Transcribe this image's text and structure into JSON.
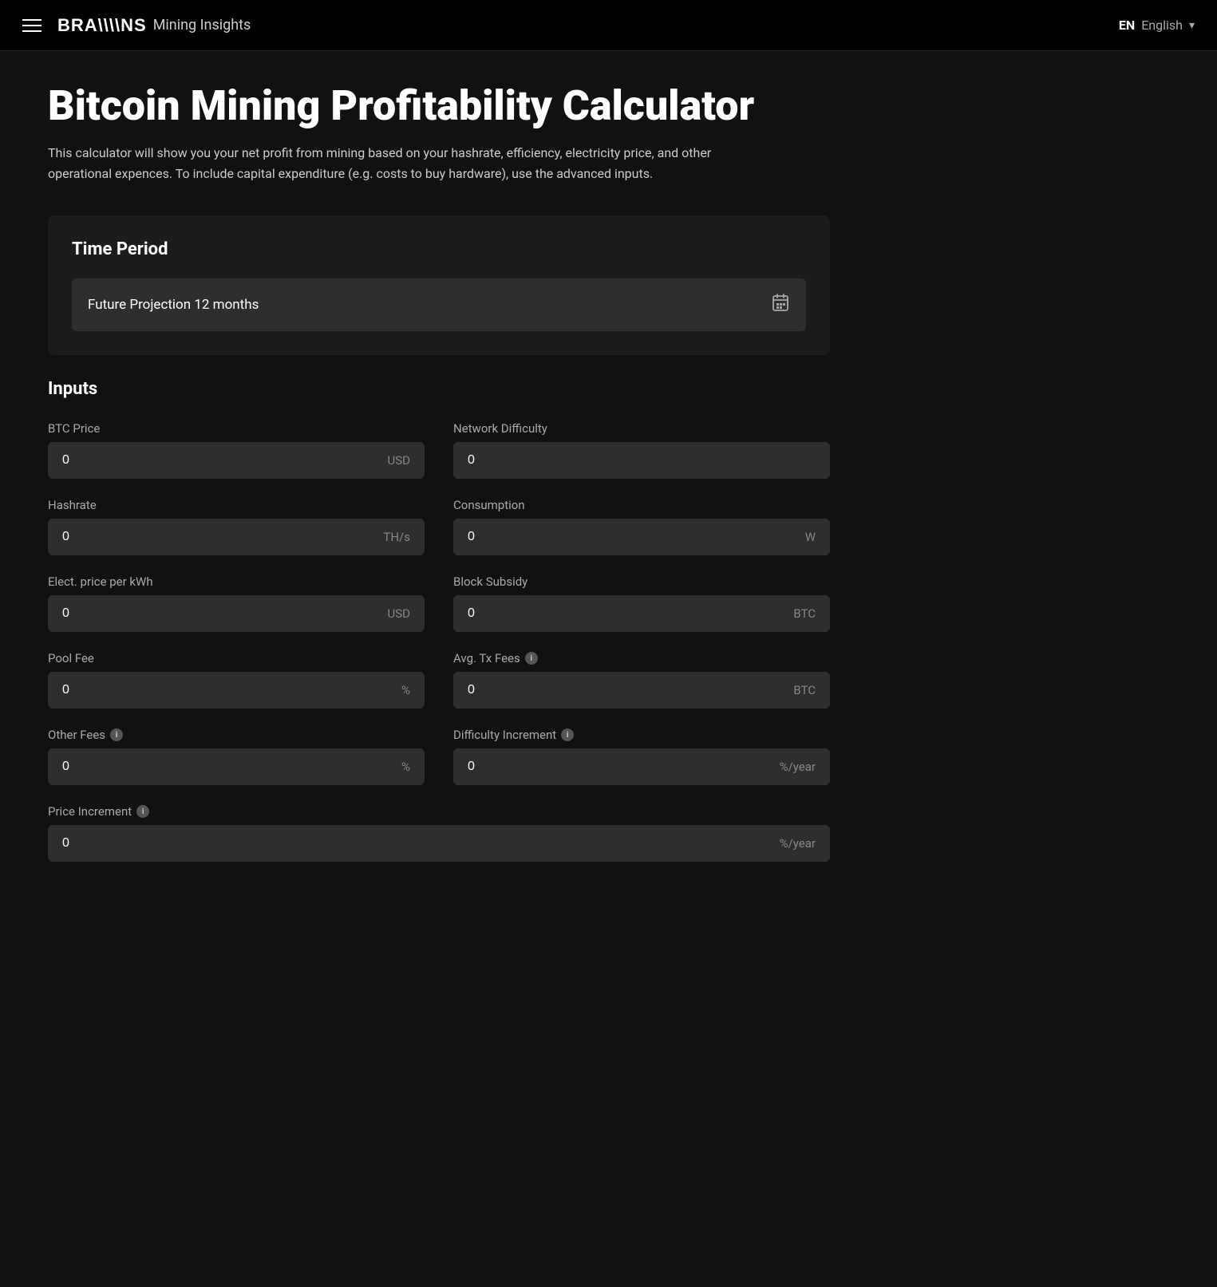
{
  "navbar": {
    "menu_icon": "hamburger",
    "brand_name": "BRA\\\\NS",
    "brand_subtitle": "Mining Insights",
    "lang_code": "EN",
    "lang_name": "English",
    "chevron": "▾"
  },
  "page": {
    "title": "Bitcoin Mining Profitability Calculator",
    "description": "This calculator will show you your net profit from mining based on your hashrate, efficiency, electricity price, and other operational expences. To include capital expenditure (e.g. costs to buy hardware), use the advanced inputs."
  },
  "time_period": {
    "section_title": "Time Period",
    "selected_value": "Future Projection 12 months",
    "calendar_icon": "📅"
  },
  "inputs": {
    "section_title": "Inputs",
    "fields": [
      {
        "label": "BTC Price",
        "value": "0",
        "unit": "USD",
        "has_info": false,
        "id": "btc-price"
      },
      {
        "label": "Network Difficulty",
        "value": "0",
        "unit": "",
        "has_info": false,
        "id": "network-difficulty"
      },
      {
        "label": "Hashrate",
        "value": "0",
        "unit": "TH/s",
        "has_info": false,
        "id": "hashrate"
      },
      {
        "label": "Consumption",
        "value": "0",
        "unit": "W",
        "has_info": false,
        "id": "consumption"
      },
      {
        "label": "Elect. price per kWh",
        "value": "0",
        "unit": "USD",
        "has_info": false,
        "id": "electricity-price"
      },
      {
        "label": "Block Subsidy",
        "value": "0",
        "unit": "BTC",
        "has_info": false,
        "id": "block-subsidy"
      },
      {
        "label": "Pool Fee",
        "value": "0",
        "unit": "%",
        "has_info": false,
        "id": "pool-fee"
      },
      {
        "label": "Avg. Tx Fees",
        "value": "0",
        "unit": "BTC",
        "has_info": true,
        "id": "avg-tx-fees"
      },
      {
        "label": "Other Fees",
        "value": "0",
        "unit": "%",
        "has_info": true,
        "id": "other-fees"
      },
      {
        "label": "Difficulty Increment",
        "value": "0",
        "unit": "%/year",
        "has_info": true,
        "id": "difficulty-increment"
      }
    ],
    "full_width_fields": [
      {
        "label": "Price Increment",
        "value": "0",
        "unit": "%/year",
        "has_info": true,
        "id": "price-increment"
      }
    ]
  }
}
